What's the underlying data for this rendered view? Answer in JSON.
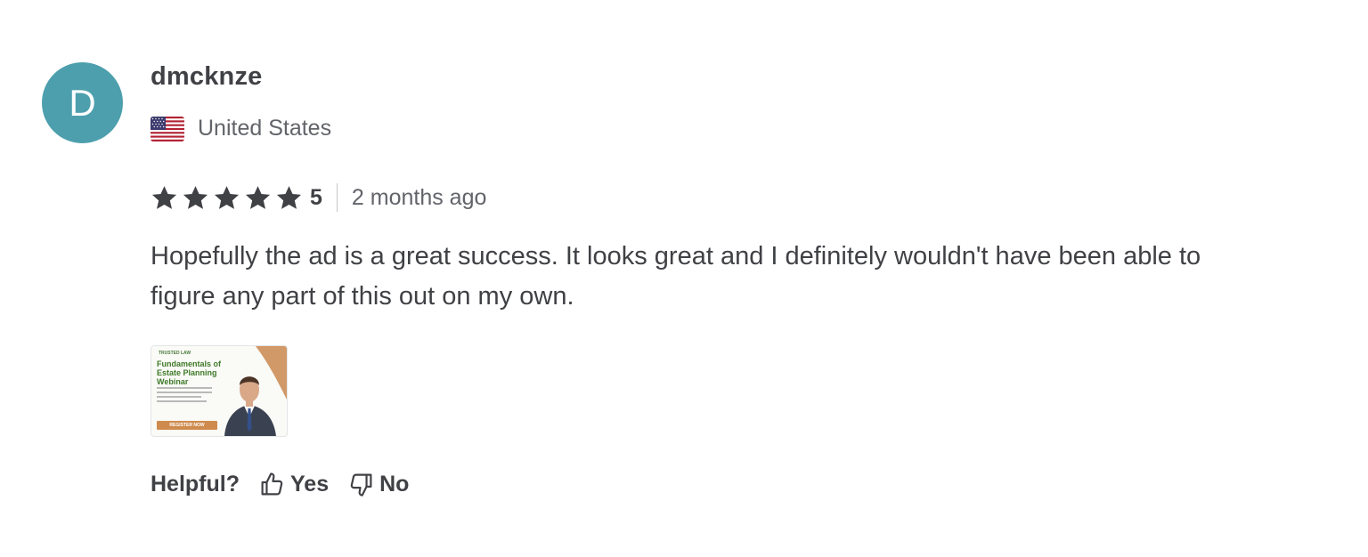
{
  "review": {
    "avatar_letter": "D",
    "avatar_color": "#4d9fad",
    "username": "dmcknze",
    "country": "United States",
    "country_flag_icon": "us-flag-icon",
    "rating": 5,
    "rating_label": "5",
    "time_ago": "2 months ago",
    "text": "Hopefully the ad is a great success. It looks great and I definitely wouldn't have been able to figure any part of this out on my own.",
    "star_color": "#404145",
    "attachment": {
      "brand": "TRUSTED LAW",
      "title": "Fundamentals of Estate Planning Webinar",
      "cta": "REGISTER NOW",
      "accent_color": "#cf8b4d"
    }
  },
  "feedback": {
    "prompt": "Helpful?",
    "yes_label": "Yes",
    "no_label": "No",
    "yes_icon": "thumbs-up-icon",
    "no_icon": "thumbs-down-icon"
  }
}
